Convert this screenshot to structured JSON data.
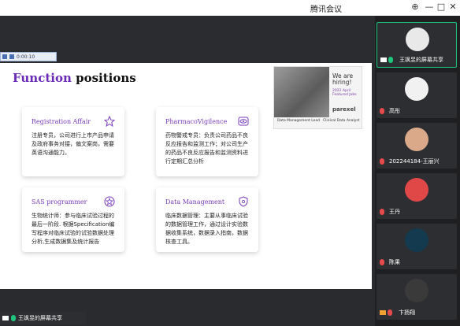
{
  "window": {
    "title": "腾讯会议"
  },
  "slide": {
    "heading_accent": "Function",
    "heading_rest": " positions",
    "player_time": "0:00:10",
    "cards": [
      {
        "title": "Registration Affair",
        "icon": "star-outline-icon",
        "body": "注册专员，公司进行上市产品申请及政府事务对接，偏文案岗，需要英语沟通能力。"
      },
      {
        "title": "PharmacoVigilence",
        "icon": "eye-icon",
        "body": "药物警戒专员：负责公司药品不良反应报告和监测工作；对公司生产的药品不良反应报告和监测资料进行定期汇总分析"
      },
      {
        "title": "SAS programmer",
        "icon": "star-circle-icon",
        "body": "生物统计师：参与临床试验过程的最后一阶段. 根据Specification编写程序对临床试验的试验数据处理分析,生成数据集及统计报告"
      },
      {
        "title": "Data Management",
        "icon": "shield-icon",
        "body": "临床数据管理：主要从事临床试验的数据管理工作，通过设计实验数据收集系统，数据录入指南，数据核查工具。"
      }
    ],
    "ad": {
      "hiring": "We are hiring!",
      "featured": "2022 April Featured Jobs",
      "brand": "parexel",
      "job1": "Data Management Lead",
      "job2": "Clinical Data Analyst"
    }
  },
  "participants": [
    {
      "name": "王飒昱的屏幕共享",
      "active": true,
      "avatar_color": "#e9e9e9"
    },
    {
      "name": "高彤",
      "active": false,
      "avatar_color": "#f1f1f1"
    },
    {
      "name": "202244184-王丽兴",
      "active": false,
      "avatar_color": "#d9a989"
    },
    {
      "name": "王丹",
      "active": false,
      "avatar_color": "#e04848"
    },
    {
      "name": "陈果",
      "active": false,
      "avatar_color": "#143a4f"
    },
    {
      "name": "卞扬翔",
      "active": false,
      "avatar_color": "#3a3a3a"
    }
  ],
  "sharebar": {
    "name": "王飒昱的屏幕共享"
  }
}
